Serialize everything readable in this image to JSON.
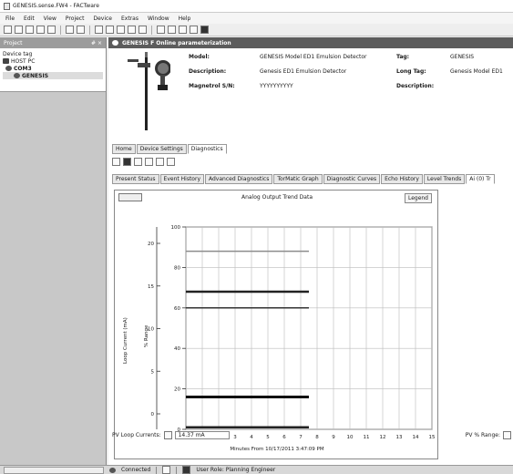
{
  "window": {
    "title": "GENESIS.sense.FW4 - FACTware"
  },
  "menu": [
    "File",
    "Edit",
    "View",
    "Project",
    "Device",
    "Extras",
    "Window",
    "Help"
  ],
  "left_panel": {
    "header": "Project",
    "pin": "# ×",
    "column": "Device tag",
    "tree": [
      "HOST PC",
      "COM3",
      "GENESIS"
    ]
  },
  "device_header": {
    "title": "GENESIS F Online parameterization"
  },
  "device_info": {
    "model_label": "Model:",
    "model_value": "GENESIS Model ED1 Emulsion Detector",
    "description_label": "Description:",
    "description_value": "Genesis ED1 Emulsion Detector",
    "magnetrol_label": "Magnetrol S/N:",
    "magnetrol_value": "YYYYYYYYYY",
    "tag_label": "Tag:",
    "tag_value": "GENESIS",
    "long_tag_label": "Long Tag:",
    "long_tag_value": "Genesis Model ED1",
    "desc2_label": "Description:",
    "desc2_value": ""
  },
  "main_tabs": [
    "Home",
    "Device Settings",
    "Diagnostics"
  ],
  "diag_tabs": [
    "Present Status",
    "Event History",
    "Advanced Diagnostics",
    "TorMatic Graph",
    "Diagnostic Curves",
    "Echo History",
    "Level Trends",
    "Ai (0) Tr"
  ],
  "chart": {
    "title": "Analog Output Trend Data",
    "legend_button": "Legend",
    "xlabel": "Minutes From 10/17/2011 3:47:09 PM",
    "ylabel_left": "Loop Current (mA)",
    "ylabel_right": "% Range"
  },
  "chart_data": {
    "type": "line",
    "x_ticks": [
      0,
      1,
      2,
      3,
      4,
      5,
      6,
      7,
      8,
      9,
      10,
      11,
      12,
      13,
      14,
      15
    ],
    "y_left_ticks": [
      0,
      5,
      10,
      15,
      20
    ],
    "y_right_ticks": [
      0,
      20,
      40,
      60,
      80,
      100
    ],
    "xlim": [
      0,
      15
    ],
    "y_right_lim": [
      0,
      100
    ],
    "series": [
      {
        "x": [
          0,
          7.5
        ],
        "y": [
          88,
          88
        ],
        "color": "#8c8c8c",
        "width": 1.5
      },
      {
        "x": [
          0,
          7.5
        ],
        "y": [
          68,
          68
        ],
        "color": "#222222",
        "width": 2.5
      },
      {
        "x": [
          0,
          7.5
        ],
        "y": [
          60,
          60
        ],
        "color": "#333333",
        "width": 1.5
      },
      {
        "x": [
          0,
          7.5
        ],
        "y": [
          16,
          16
        ],
        "color": "#111111",
        "width": 3
      },
      {
        "x": [
          0,
          7.5
        ],
        "y": [
          1,
          1
        ],
        "color": "#222222",
        "width": 2.5
      }
    ]
  },
  "footer": {
    "loop_label": "PV Loop Currents:",
    "loop_value": "14.37 mA",
    "pv_label": "PV % Range:"
  },
  "status": {
    "connected": "Connected",
    "mode": "User Role: Planning Engineer"
  }
}
